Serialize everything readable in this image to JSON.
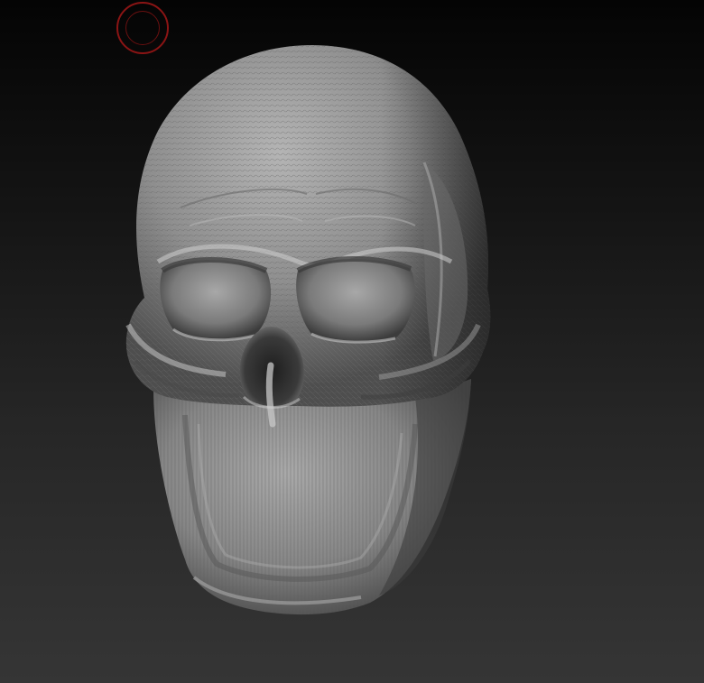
{
  "viewport": {
    "background_top": "#040404",
    "background_bottom": "#353535"
  },
  "brush": {
    "icon": "brush-cursor-icon",
    "color": "#8a1414"
  },
  "model": {
    "icon": "skull-mesh",
    "material": "matcap-gray",
    "base_color": "#8c8c8c"
  }
}
